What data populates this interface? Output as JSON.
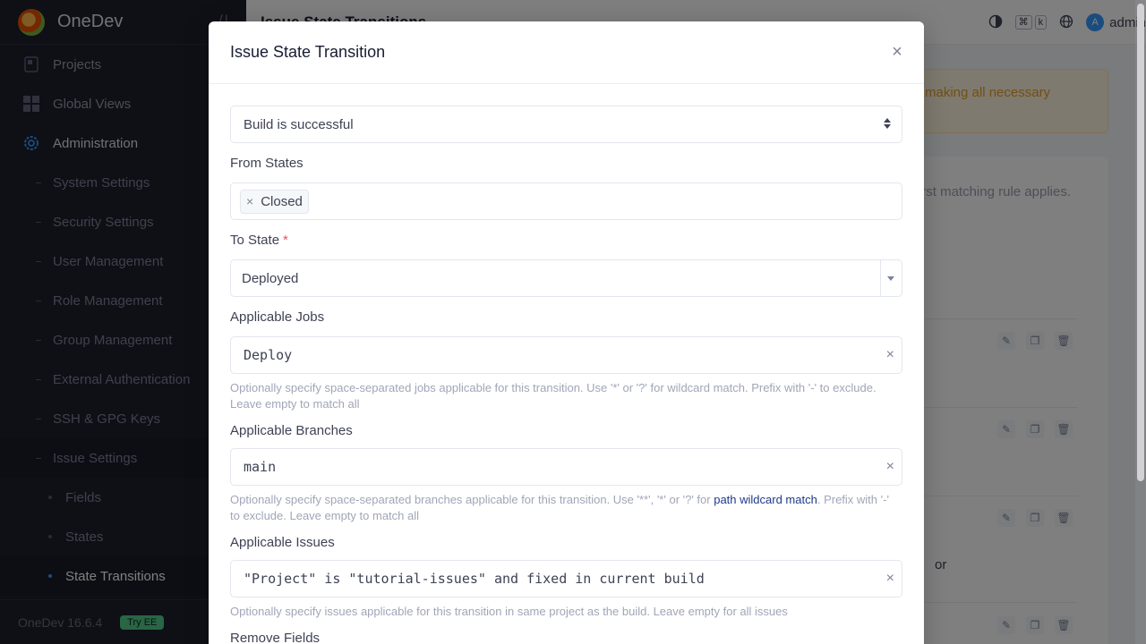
{
  "sidebar": {
    "brand": "OneDev",
    "items": [
      {
        "label": "Projects"
      },
      {
        "label": "Global Views"
      },
      {
        "label": "Administration"
      }
    ],
    "admin_subs": [
      {
        "label": "System Settings"
      },
      {
        "label": "Security Settings"
      },
      {
        "label": "User Management"
      },
      {
        "label": "Role Management"
      },
      {
        "label": "Group Management"
      },
      {
        "label": "External Authentication"
      },
      {
        "label": "SSH & GPG Keys"
      },
      {
        "label": "Issue Settings"
      }
    ],
    "issue_subs": [
      {
        "label": "Fields"
      },
      {
        "label": "States"
      },
      {
        "label": "State Transitions"
      }
    ],
    "version": "OneDev 16.6.4",
    "try_ee": "Try EE"
  },
  "topbar": {
    "title": "Issue State Transitions",
    "kbd_cmd": "⌘",
    "kbd_k": "k",
    "user": "admin",
    "avatar_letter": "A"
  },
  "background": {
    "warning_text": "making all necessary",
    "card_desc": "rst matching rule applies.",
    "row3_tail": "or"
  },
  "modal": {
    "title": "Issue State Transition",
    "trigger": "Build is successful",
    "from_states_label": "From States",
    "from_states": [
      "Closed"
    ],
    "to_state_label": "To State",
    "to_state_required": "*",
    "to_state_value": "Deployed",
    "jobs_label": "Applicable Jobs",
    "jobs_value": "Deploy",
    "jobs_help": "Optionally specify space-separated jobs applicable for this transition. Use '*' or '?' for wildcard match. Prefix with '-' to exclude. Leave empty to match all",
    "branches_label": "Applicable Branches",
    "branches_value": "main",
    "branches_help_pre": "Optionally specify space-separated branches applicable for this transition. Use '**', '*' or '?' for ",
    "branches_help_link": "path wildcard match",
    "branches_help_post": ". Prefix with '-' to exclude. Leave empty to match all",
    "issues_label": "Applicable Issues",
    "issues_value": "\"Project\" is \"tutorial-issues\" and fixed in current build",
    "issues_help": "Optionally specify issues applicable for this transition in same project as the build. Leave empty for all issues",
    "remove_fields_label": "Remove Fields"
  }
}
